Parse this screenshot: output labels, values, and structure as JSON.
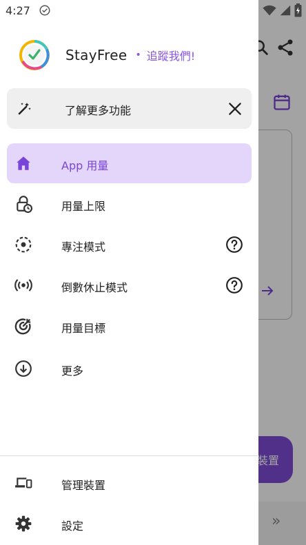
{
  "status_bar": {
    "time": "4:27"
  },
  "background": {
    "fab_label": "裝置"
  },
  "brand": {
    "name": "StayFree",
    "separator": "•",
    "follow_label": "追蹤我們!"
  },
  "promo": {
    "label": "了解更多功能"
  },
  "nav": {
    "items": [
      {
        "label": "App 用量",
        "icon": "home-icon",
        "active": true
      },
      {
        "label": "用量上限",
        "icon": "lock-clock-icon"
      },
      {
        "label": "專注模式",
        "icon": "focus-icon",
        "help": true
      },
      {
        "label": "倒數休止模式",
        "icon": "broadcast-icon",
        "help": true
      },
      {
        "label": "用量目標",
        "icon": "target-icon"
      },
      {
        "label": "更多",
        "icon": "download-circle-icon"
      }
    ],
    "bottom_items": [
      {
        "label": "管理裝置",
        "icon": "devices-icon"
      },
      {
        "label": "設定",
        "icon": "gear-icon"
      }
    ]
  },
  "colors": {
    "accent": "#7a44d8",
    "active_bg": "#e4d6fb"
  }
}
